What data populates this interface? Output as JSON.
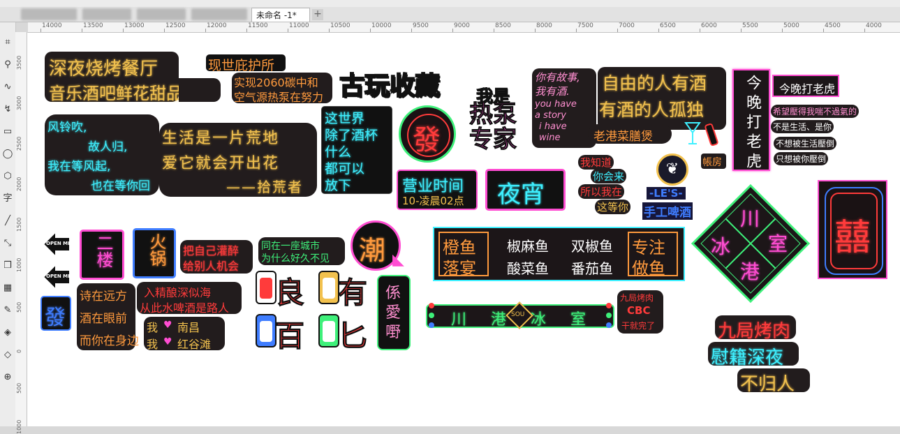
{
  "document_tab": {
    "title": "未命名 -1*",
    "add_label": "+"
  },
  "ruler_ticks": [
    "14000",
    "13500",
    "13000",
    "12500",
    "12000",
    "11500",
    "11000",
    "10500",
    "10000",
    "9500",
    "9000",
    "8500",
    "8000",
    "7500",
    "7000",
    "6500",
    "6000",
    "5500",
    "5000",
    "4500",
    "4000"
  ],
  "vruler_ticks": [
    "3500",
    "3000",
    "2500",
    "2000",
    "1500",
    "1000",
    "500",
    "0",
    "500",
    "1000"
  ],
  "tools": [
    "crop-icon",
    "zoom-icon",
    "freehand-icon",
    "curve-icon",
    "rectangle-icon",
    "ellipse-icon",
    "polygon-icon",
    "text-icon",
    "line-icon",
    "connector-icon",
    "shadow-icon",
    "transparency-icon",
    "eyedropper-icon",
    "fill-icon",
    "smart-fill-icon",
    "add-icon"
  ],
  "signs": {
    "s1": {
      "line1": "深夜烧烤餐厅",
      "line2": "音乐酒吧鲜花甜品"
    },
    "s2": {
      "text": "现世庇护所"
    },
    "s3": {
      "line1": "实现2060碳中和",
      "line2": "空气源热泵在努力"
    },
    "s4": {
      "text": "古玩收藏"
    },
    "s5": {
      "line1": "我是",
      "line2": "热泵专家"
    },
    "s6": {
      "line1": "你有故事,",
      "line2": "我有酒.",
      "line3": "you have",
      "line4": "a story",
      "line5": "i have",
      "line6": "wine"
    },
    "s7": {
      "line1": "自由的人有酒",
      "line2": "有酒的人孤独"
    },
    "s8": {
      "text": "老港菜膳煲"
    },
    "s9": {
      "text": "今晚打老虎"
    },
    "s10": {
      "text": "今晚打老虎"
    },
    "s11": {
      "line1": "希望壓得我喘不過氣的",
      "line2": "不是生活、是你",
      "line3": "不想被生活壓倒",
      "line4": "只想被你壓倒"
    },
    "s12": {
      "line1": "风铃吹,",
      "line2": "故人归,",
      "line3": "我在等风起,",
      "line4": "也在等你回"
    },
    "s13": {
      "line1": "生活是一片荒地",
      "line2": "爱它就会开出花",
      "line3": "——拾荒者"
    },
    "s14": {
      "line1": "这世界",
      "line2": "除了酒杯",
      "line3": "什么",
      "line4": "都可以",
      "line5": "放下"
    },
    "s15": {
      "text": "發"
    },
    "s16": {
      "line1": "营业时间",
      "line2": "10-凌晨02点"
    },
    "s17": {
      "text": "夜宵"
    },
    "s18": {
      "line1": "我知道",
      "line2": "你会来",
      "line3": "所以我在",
      "line4": "这等你"
    },
    "s19": {
      "line1": "-LE'S-",
      "line2": "手工啤酒"
    },
    "s20": {
      "text": "帳房"
    },
    "s21": {
      "c1": "川",
      "c2": "冰",
      "c3": "室",
      "c4": "港"
    },
    "s22": {
      "text": "囍"
    },
    "s23": {
      "text": "OPEN ME"
    },
    "s24": {
      "text": "OPEN ME"
    },
    "s25": {
      "text": "二楼"
    },
    "s26": {
      "text": "火锅"
    },
    "s27": {
      "line1": "把自己灌醉",
      "line2": "给别人机会"
    },
    "s28": {
      "line1": "同在一座城市",
      "line2": "为什么好久不见"
    },
    "s29": {
      "text": "潮"
    },
    "s30": {
      "l1": "橙鱼",
      "l2": "落宴",
      "m1": "椒麻鱼",
      "m2": "双椒鱼",
      "m3": "酸菜鱼",
      "m4": "番茄鱼",
      "r1": "专注",
      "r2": "做鱼"
    },
    "s31": {
      "text": "發"
    },
    "s32": {
      "line1": "诗在远方",
      "line2": "酒在眼前",
      "line3": "而你在身边"
    },
    "s33": {
      "line1": "入精酿深似海",
      "line2": "从此水啤酒是路人"
    },
    "s34": {
      "line1": "我",
      "line2": "南昌",
      "line3": "我",
      "line4": "红谷滩"
    },
    "s35": {
      "c1": "良",
      "c2": "有",
      "c3": "百",
      "c4": "匕"
    },
    "s36": {
      "line1": "係",
      "line2": "愛",
      "line3": "嘢"
    },
    "s37": {
      "text": "川 港 冰 室",
      "center": "SOU"
    },
    "s38": {
      "line1": "九局烤肉",
      "line2": "CBC",
      "line3": "干就完了"
    },
    "s39": {
      "line1": "九局烤肉",
      "line2": "慰籍深夜",
      "line3": "不归人"
    }
  }
}
